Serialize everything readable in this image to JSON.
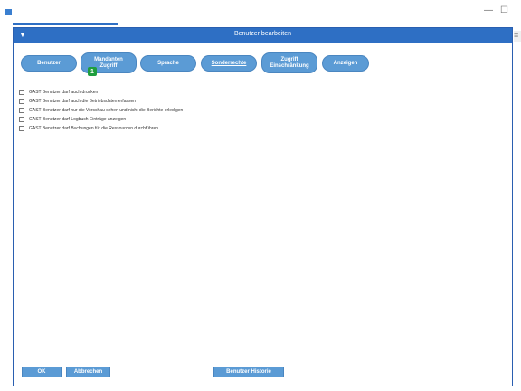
{
  "window": {
    "min_glyph": "—",
    "max_glyph": "☐",
    "side_glyph": "≡"
  },
  "dialog": {
    "title": "Benutzer bearbeiten",
    "title_icon": "▼",
    "accent_color": "#2e6fc4"
  },
  "tabs": [
    {
      "label": "Benutzer"
    },
    {
      "label": "Mandanten Zugriff",
      "badge": "1"
    },
    {
      "label": "Sprache"
    },
    {
      "label": "Sonderrechte",
      "active": true
    },
    {
      "label": "Zugriff Einschränkung"
    },
    {
      "label": "Anzeigen"
    }
  ],
  "options": [
    {
      "label": "GAST Benutzer darf auch drucken",
      "checked": false
    },
    {
      "label": "GAST Benutzer darf auch die Betriebsdaten erfassen",
      "checked": false
    },
    {
      "label": "GAST Benutzer darf nur die Vorschau sehen und nicht die Berichte erledigen",
      "checked": false
    },
    {
      "label": "GAST Benutzer darf Logbuch Einträge anzeigen",
      "checked": false
    },
    {
      "label": "GAST Benutzer darf Buchungen für die Ressourcen durchführen",
      "checked": false
    }
  ],
  "buttons": {
    "ok": "OK",
    "cancel": "Abbrechen",
    "history": "Benutzer Historie"
  }
}
